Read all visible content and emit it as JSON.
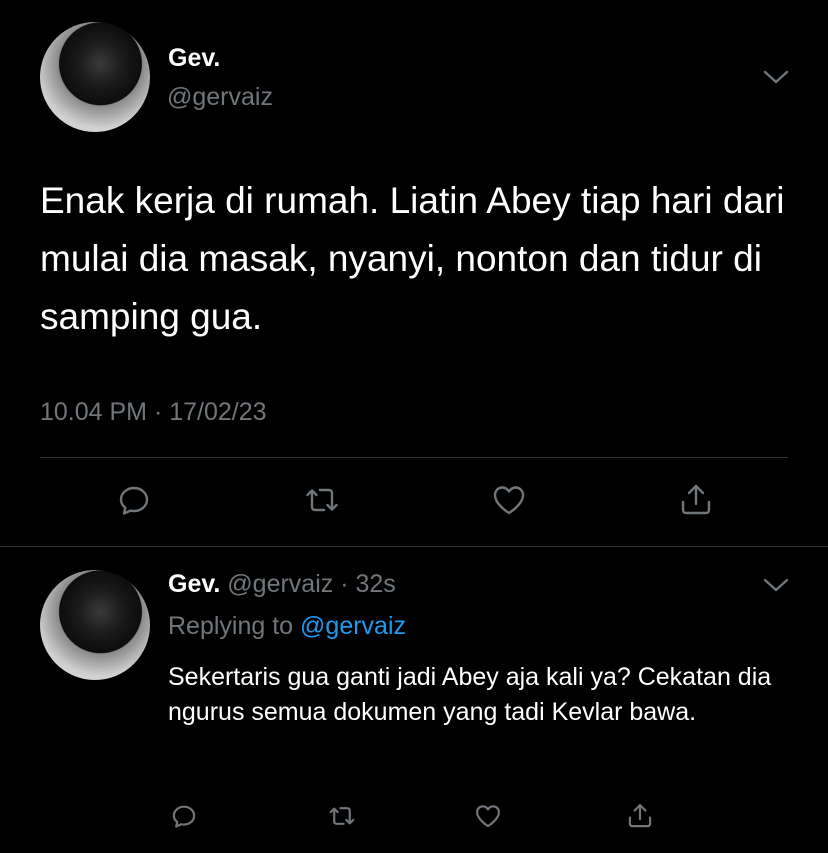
{
  "main_tweet": {
    "display_name": "Gev.",
    "handle": "@gervaiz",
    "text": "Enak kerja di rumah. Liatin Abey tiap hari dari mulai dia masak, nyanyi, nonton dan tidur di samping gua.",
    "timestamp": "10.04 PM · 17/02/23",
    "actions": [
      "reply-icon",
      "retweet-icon",
      "like-icon",
      "share-icon"
    ]
  },
  "reply_tweet": {
    "display_name": "Gev.",
    "handle_and_time": "@gervaiz · 32s",
    "replying_prefix": "Replying to ",
    "replying_to": "@gervaiz",
    "text": "Sekertaris gua ganti jadi Abey aja kali ya? Cekatan dia ngurus semua dokumen yang tadi Kevlar bawa.",
    "actions": [
      "reply-icon",
      "retweet-icon",
      "like-icon",
      "share-icon"
    ]
  },
  "colors": {
    "background": "#000000",
    "text_primary": "#ffffff",
    "text_secondary": "#71767b",
    "accent": "#1d9bf0",
    "divider": "#2f3336"
  }
}
